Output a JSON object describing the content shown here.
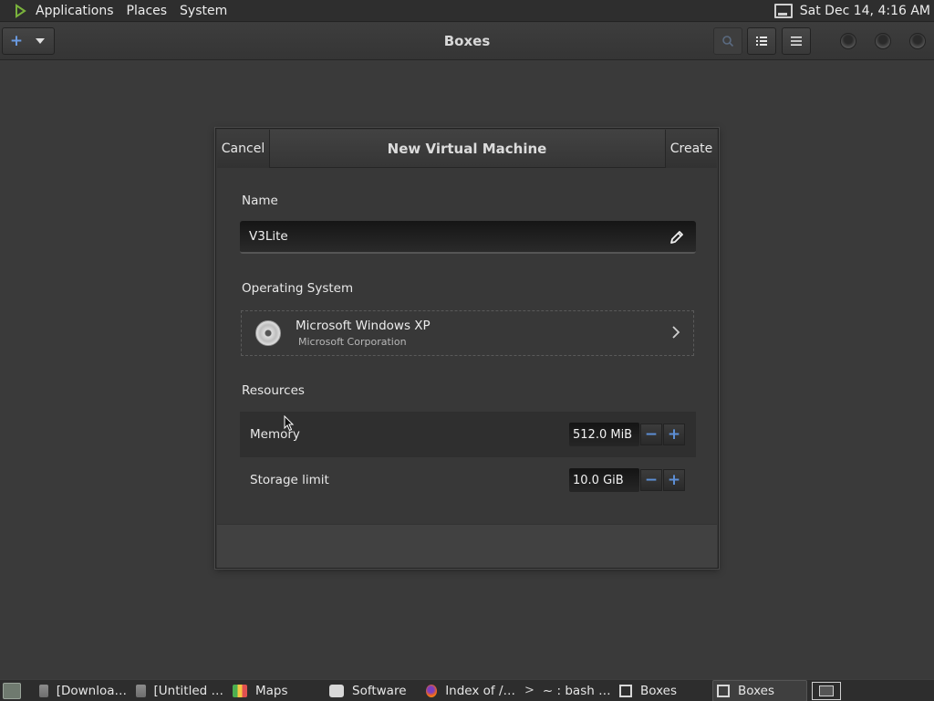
{
  "top_panel": {
    "menus": [
      "Applications",
      "Places",
      "System"
    ],
    "clock": "Sat Dec 14,  4:16 AM"
  },
  "header_bar": {
    "title": "Boxes",
    "new_icon": "plus-icon",
    "buttons": [
      "search-icon",
      "selection-mode-icon",
      "hamburger-menu-icon"
    ]
  },
  "dialog": {
    "title": "New Virtual Machine",
    "cancel_label": "Cancel",
    "create_label": "Create",
    "name_section": "Name",
    "name_value": "V3Lite",
    "os_section": "Operating System",
    "os_name": "Microsoft Windows XP",
    "os_vendor": "Microsoft Corporation",
    "resources_section": "Resources",
    "memory_label": "Memory",
    "memory_value": "512.0 MiB",
    "storage_label": "Storage limit",
    "storage_value": "10.0 GiB"
  },
  "taskbar": {
    "tasks": [
      {
        "label": "[Downloa…",
        "icon": "folder-icon"
      },
      {
        "label": "[Untitled …",
        "icon": "document-icon"
      },
      {
        "label": "Maps",
        "icon": "maps-icon"
      },
      {
        "label": "Software",
        "icon": "software-icon"
      },
      {
        "label": "Index of /…",
        "icon": "firefox-icon"
      },
      {
        "label": "~ : bash …",
        "icon": "terminal-icon"
      },
      {
        "label": "Boxes",
        "icon": "boxes-icon"
      },
      {
        "label": "Boxes",
        "icon": "boxes-icon"
      }
    ]
  },
  "colors": {
    "background": "#3a3a3a",
    "panel": "#2e2e2e",
    "accent": "#5d8fd6"
  }
}
